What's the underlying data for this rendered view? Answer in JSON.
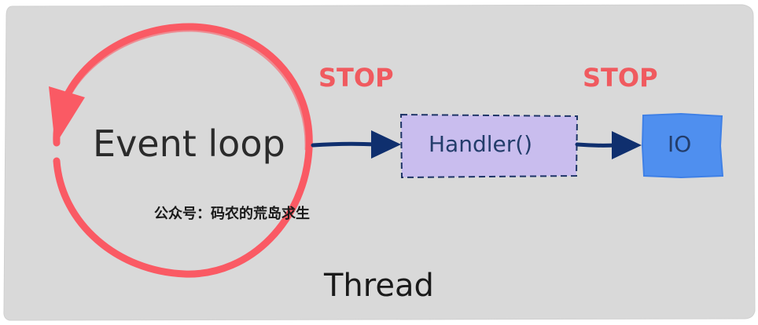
{
  "diagram": {
    "container_label": "Thread",
    "loop_label": "Event loop",
    "handler_label": "Handler()",
    "io_label": "IO",
    "stop_labels": [
      "STOP",
      "STOP"
    ],
    "watermark": "公众号：码农的荒岛求生"
  },
  "colors": {
    "container_fill": "#d9d9d9",
    "loop_stroke": "#fa5a64",
    "arrow": "#0f2f6e",
    "handler_fill": "#c9bdee",
    "handler_border": "#1d3466",
    "io_fill": "#4f8fef",
    "stop_text": "#f05a5f"
  }
}
